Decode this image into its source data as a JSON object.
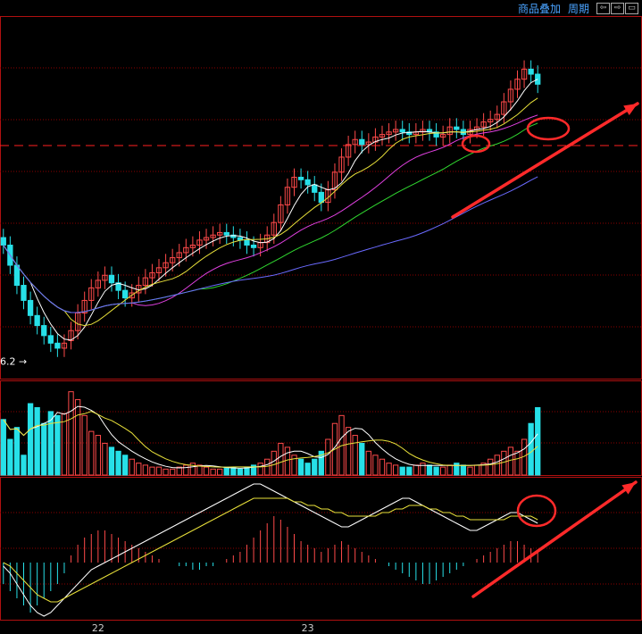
{
  "toolbar": {
    "overlay_label": "商品叠加",
    "period_label": "周期",
    "nav_buttons": [
      "⇦",
      "⇨",
      "▭"
    ]
  },
  "colors": {
    "up": "#ff4a4a",
    "down": "#27e0e8",
    "ma5": "#ffffff",
    "ma10": "#e8e03a",
    "ma20": "#e040e0",
    "ma30": "#30d830",
    "ma60": "#6a6aff",
    "grid": "#8b0000",
    "annotation": "#ff2a2a",
    "macd_dif": "#ffffff",
    "macd_dea": "#e8e03a"
  },
  "chart_data": {
    "type": "candlestick",
    "low_marker": "6.2",
    "x_ticks": [
      "22",
      "23"
    ],
    "price_panel": {
      "grid_lines": 6,
      "closes": [
        10.6,
        9.8,
        9.0,
        8.4,
        7.8,
        7.4,
        7.0,
        6.7,
        6.5,
        6.7,
        7.2,
        7.9,
        8.4,
        8.9,
        9.2,
        9.4,
        9.1,
        8.8,
        8.5,
        8.7,
        9.0,
        9.3,
        9.5,
        9.7,
        9.9,
        10.1,
        10.3,
        10.5,
        10.6,
        10.8,
        10.9,
        11.0,
        11.1,
        11.0,
        10.9,
        10.8,
        10.6,
        10.5,
        10.7,
        11.0,
        11.5,
        12.2,
        12.9,
        13.3,
        13.2,
        13.0,
        12.7,
        12.3,
        12.8,
        13.5,
        14.1,
        14.6,
        14.8,
        14.6,
        14.7,
        14.9,
        15.0,
        15.1,
        15.2,
        15.1,
        15.0,
        15.1,
        15.2,
        15.1,
        14.9,
        15.0,
        15.3,
        15.2,
        15.0,
        15.2,
        15.3,
        15.5,
        15.6,
        15.8,
        16.3,
        16.8,
        17.2,
        17.6,
        17.4,
        17.0
      ],
      "opens": [
        10.9,
        10.6,
        9.8,
        9.0,
        8.4,
        7.8,
        7.4,
        7.0,
        6.7,
        6.5,
        6.8,
        7.2,
        7.9,
        8.4,
        8.9,
        9.2,
        9.4,
        9.1,
        8.8,
        8.5,
        8.7,
        9.0,
        9.3,
        9.5,
        9.7,
        9.9,
        10.1,
        10.3,
        10.5,
        10.6,
        10.8,
        10.9,
        11.0,
        11.1,
        11.0,
        10.9,
        10.8,
        10.6,
        10.5,
        10.7,
        11.0,
        11.5,
        12.2,
        12.9,
        13.3,
        13.2,
        13.0,
        12.7,
        12.3,
        12.8,
        13.5,
        14.1,
        14.6,
        14.8,
        14.6,
        14.7,
        14.9,
        15.0,
        15.1,
        15.2,
        15.1,
        15.0,
        15.1,
        15.2,
        15.1,
        14.9,
        15.0,
        15.3,
        15.2,
        15.0,
        15.2,
        15.3,
        15.5,
        15.6,
        15.8,
        16.3,
        16.8,
        17.2,
        17.6,
        17.4
      ],
      "ma_series": [
        "MA5",
        "MA10",
        "MA20",
        "MA30",
        "MA60"
      ],
      "y_range": [
        6.0,
        19.0
      ]
    },
    "volume_panel": {
      "values": [
        28,
        18,
        24,
        10,
        36,
        34,
        26,
        32,
        30,
        31,
        42,
        38,
        30,
        22,
        20,
        16,
        14,
        12,
        10,
        8,
        6,
        5,
        4,
        4,
        3,
        3,
        4,
        5,
        6,
        5,
        4,
        3,
        3,
        4,
        4,
        3,
        4,
        5,
        6,
        8,
        12,
        16,
        14,
        10,
        8,
        6,
        8,
        12,
        18,
        26,
        30,
        24,
        20,
        16,
        12,
        10,
        8,
        6,
        5,
        4,
        4,
        5,
        6,
        5,
        4,
        4,
        5,
        6,
        5,
        4,
        5,
        6,
        8,
        10,
        12,
        14,
        12,
        18,
        26,
        34
      ],
      "y_range": [
        0,
        45
      ]
    },
    "macd_panel": {
      "hist": [
        -6,
        -8,
        -10,
        -12,
        -14,
        -12,
        -10,
        -8,
        -6,
        -3,
        2,
        5,
        7,
        8,
        9,
        9,
        8,
        7,
        6,
        5,
        4,
        3,
        2,
        1,
        0,
        0,
        -1,
        -1,
        -2,
        -2,
        -1,
        -1,
        0,
        1,
        2,
        3,
        5,
        7,
        9,
        11,
        13,
        12,
        10,
        8,
        6,
        5,
        4,
        3,
        4,
        5,
        6,
        5,
        4,
        3,
        2,
        1,
        0,
        -1,
        -2,
        -3,
        -4,
        -5,
        -6,
        -6,
        -5,
        -4,
        -3,
        -2,
        -1,
        0,
        1,
        2,
        3,
        4,
        5,
        6,
        6,
        5,
        4,
        3
      ],
      "dif": [
        -1,
        -3,
        -6,
        -9,
        -12,
        -14,
        -15,
        -14,
        -12,
        -10,
        -8,
        -6,
        -4,
        -2,
        -1,
        0,
        1,
        2,
        3,
        4,
        5,
        6,
        7,
        8,
        9,
        10,
        11,
        12,
        13,
        14,
        15,
        16,
        17,
        18,
        19,
        20,
        21,
        22,
        22,
        21,
        20,
        19,
        18,
        17,
        16,
        15,
        14,
        13,
        12,
        11,
        10,
        10,
        11,
        12,
        13,
        14,
        15,
        16,
        17,
        18,
        18,
        17,
        16,
        15,
        14,
        13,
        12,
        11,
        10,
        9,
        9,
        10,
        11,
        12,
        13,
        14,
        14,
        13,
        12,
        11
      ],
      "dea": [
        0,
        -1,
        -3,
        -5,
        -7,
        -9,
        -10,
        -11,
        -11,
        -10,
        -9,
        -8,
        -7,
        -6,
        -5,
        -4,
        -3,
        -2,
        -1,
        0,
        1,
        2,
        3,
        4,
        5,
        6,
        7,
        8,
        9,
        10,
        11,
        12,
        13,
        14,
        15,
        16,
        17,
        18,
        18,
        18,
        18,
        18,
        18,
        17,
        17,
        16,
        16,
        15,
        15,
        14,
        14,
        13,
        13,
        13,
        13,
        13,
        14,
        14,
        15,
        15,
        16,
        16,
        16,
        15,
        15,
        14,
        14,
        13,
        13,
        12,
        12,
        12,
        12,
        12,
        12,
        13,
        13,
        13,
        13,
        12
      ],
      "y_range": [
        -16,
        24
      ]
    }
  }
}
